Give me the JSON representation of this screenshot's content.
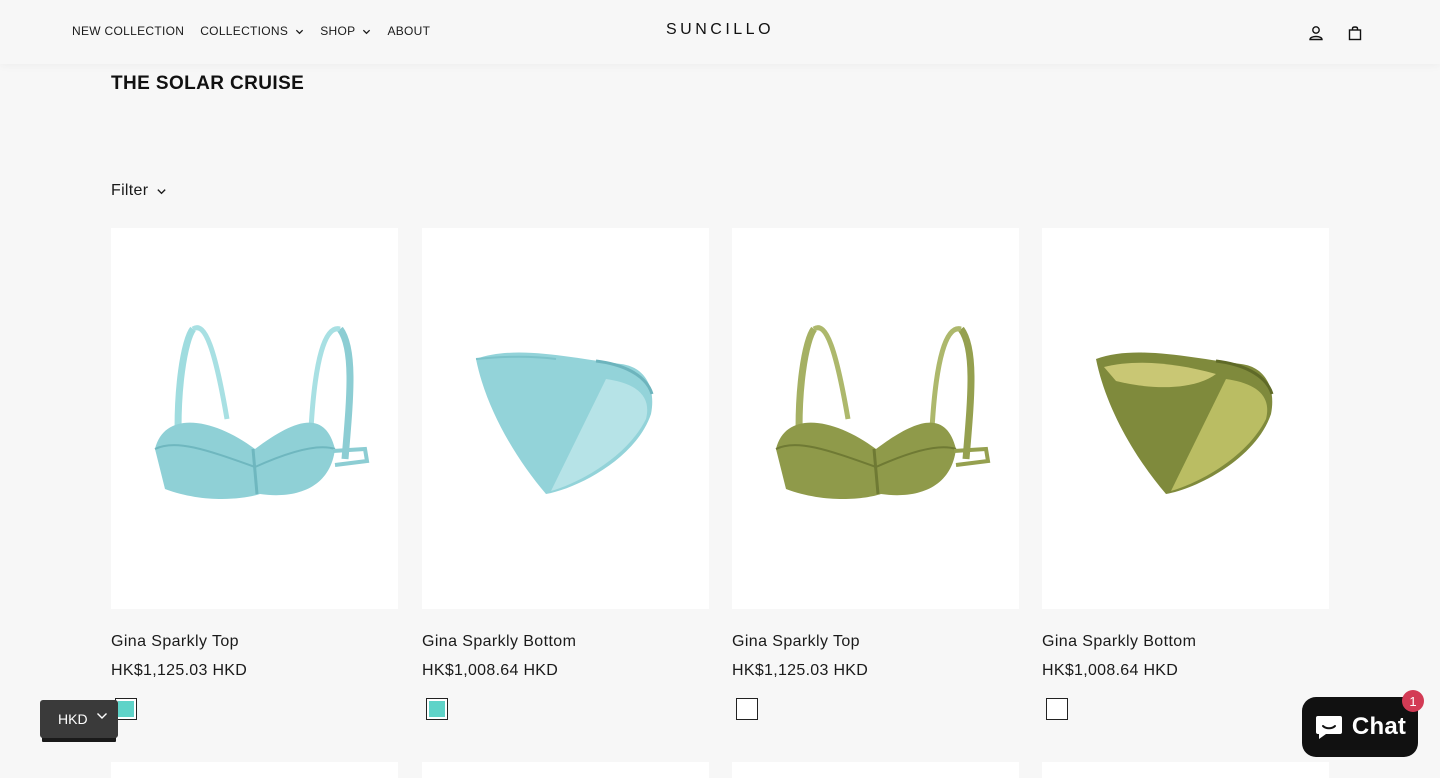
{
  "header": {
    "nav": [
      {
        "label": "NEW COLLECTION",
        "has_dropdown": false
      },
      {
        "label": "COLLECTIONS",
        "has_dropdown": true
      },
      {
        "label": "SHOP",
        "has_dropdown": true
      },
      {
        "label": "ABOUT",
        "has_dropdown": false
      }
    ],
    "logo": "SUNCILLO",
    "icons": [
      "account-icon",
      "cart-icon"
    ]
  },
  "page": {
    "title": "THE SOLAR CRUISE",
    "filter_label": "Filter"
  },
  "products": [
    {
      "name": "Gina Sparkly Top",
      "price": "HK$1,125.03 HKD",
      "image": "bikini-top-aqua",
      "color": "#8fd0d6",
      "swatch_color": "#5fd3c8"
    },
    {
      "name": "Gina Sparkly Bottom",
      "price": "HK$1,008.64 HKD",
      "image": "bikini-bottom-aqua",
      "color": "#8fd0d6",
      "swatch_color": "#5fd3c8"
    },
    {
      "name": "Gina Sparkly Top",
      "price": "HK$1,125.03 HKD",
      "image": "bikini-top-olive",
      "color": "#8f9a4a",
      "swatch_color": "#ffffff"
    },
    {
      "name": "Gina Sparkly Bottom",
      "price": "HK$1,008.64 HKD",
      "image": "bikini-bottom-olive",
      "color": "#7f8a3c",
      "swatch_color": "#ffffff"
    }
  ],
  "currency_selector": {
    "value": "HKD"
  },
  "chat": {
    "label": "Chat",
    "badge": "1"
  },
  "colors": {
    "background": "#f7f7f7",
    "text": "#1a1a1a",
    "chat_bg": "#111111",
    "badge": "#d33b55"
  }
}
